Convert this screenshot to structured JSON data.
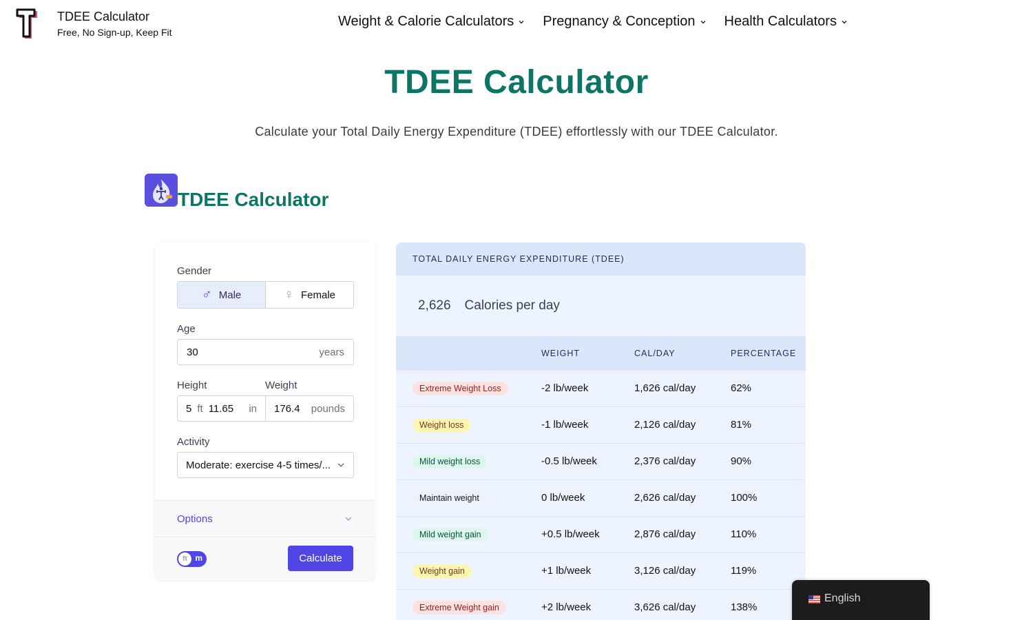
{
  "header": {
    "brand_title": "TDEE Calculator",
    "brand_tagline": "Free, No Sign-up, Keep Fit",
    "nav": [
      {
        "label": "Weight & Calorie Calculators",
        "icon": "chevron-down-icon"
      },
      {
        "label": "Pregnancy & Conception",
        "icon": "chevron-down-icon"
      },
      {
        "label": "Health Calculators",
        "icon": "chevron-down-icon"
      }
    ]
  },
  "page": {
    "title": "TDEE Calculator",
    "subtitle": "Calculate your Total Daily Energy Expenditure (TDEE) effortlessly with our TDEE Calculator.",
    "section_title": "TDEE Calculator"
  },
  "form": {
    "gender_label": "Gender",
    "gender_options": [
      {
        "label": "Male",
        "icon": "male-icon",
        "glyph": "♂",
        "selected": true
      },
      {
        "label": "Female",
        "icon": "female-icon",
        "glyph": "♀",
        "selected": false
      }
    ],
    "age_label": "Age",
    "age_value": "30",
    "age_unit": "years",
    "height_label": "Height",
    "height_ft": "5",
    "height_ft_unit": "ft",
    "height_in": "11.65",
    "height_in_unit": "in",
    "weight_label": "Weight",
    "weight_value": "176.4",
    "weight_unit": "pounds",
    "activity_label": "Activity",
    "activity_value": "Moderate: exercise 4-5 times/...",
    "options_label": "Options",
    "unit_toggle": {
      "off_label": "ft",
      "on_label": "m"
    },
    "calculate_label": "Calculate"
  },
  "results": {
    "header": "TOTAL DAILY ENERGY EXPENDITURE (TDEE)",
    "tdee_value": "2,626",
    "tdee_unit": "Calories per day",
    "columns": [
      "",
      "WEIGHT",
      "CAL/DAY",
      "PERCENTAGE"
    ],
    "rows": [
      {
        "goal": "Extreme Weight Loss",
        "weight": "-2 lb/week",
        "cal": "1,626 cal/day",
        "pct": "62%",
        "badge_bg": "#fde2e2",
        "badge_fg": "#9b1c1c"
      },
      {
        "goal": "Weight loss",
        "weight": "-1 lb/week",
        "cal": "2,126 cal/day",
        "pct": "81%",
        "badge_bg": "#fdf6b2",
        "badge_fg": "#723b13"
      },
      {
        "goal": "Mild weight loss",
        "weight": "-0.5 lb/week",
        "cal": "2,376 cal/day",
        "pct": "90%",
        "badge_bg": "#def7ec",
        "badge_fg": "#03543f"
      },
      {
        "goal": "Maintain weight",
        "weight": "0 lb/week",
        "cal": "2,626 cal/day",
        "pct": "100%",
        "badge_bg": "#eef2f8",
        "badge_fg": "#111827"
      },
      {
        "goal": "Mild weight gain",
        "weight": "+0.5 lb/week",
        "cal": "2,876 cal/day",
        "pct": "110%",
        "badge_bg": "#def7ec",
        "badge_fg": "#03543f"
      },
      {
        "goal": "Weight gain",
        "weight": "+1 lb/week",
        "cal": "3,126 cal/day",
        "pct": "119%",
        "badge_bg": "#fdf6b2",
        "badge_fg": "#723b13"
      },
      {
        "goal": "Extreme Weight gain",
        "weight": "+2 lb/week",
        "cal": "3,626 cal/day",
        "pct": "138%",
        "badge_bg": "#fde2e2",
        "badge_fg": "#9b1c1c"
      }
    ]
  },
  "language": {
    "label": "English",
    "flag": "us-flag-icon"
  },
  "colors": {
    "brand_green": "#0d7566",
    "accent": "#4f46e5",
    "result_bg": "#eef4ff",
    "result_header_bg": "#dae7fb"
  }
}
